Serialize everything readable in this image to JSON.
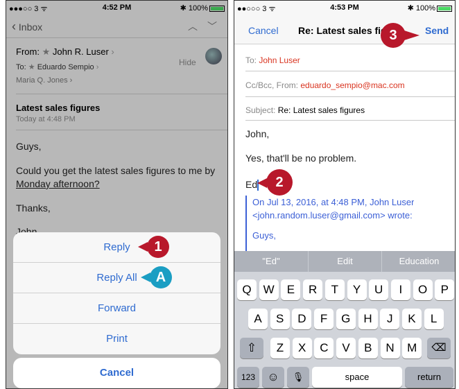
{
  "left": {
    "status": {
      "signal": "●●●○○ 3 ᯤ",
      "time": "4:52 PM",
      "battery": "✱ 100%"
    },
    "nav": {
      "back": "Inbox"
    },
    "from_label": "From:",
    "from_name": "John R. Luser",
    "to_label": "To:",
    "to_name": "Eduardo Sempio",
    "cc_name": "Maria Q. Jones",
    "hide": "Hide",
    "subject": "Latest sales figures",
    "date": "Today at 4:48 PM",
    "body": {
      "greeting": "Guys,",
      "line1": "Could you get the latest sales figures to me by",
      "line2": "Monday afternoon?",
      "thanks": "Thanks,",
      "sig": "John"
    },
    "sheet": {
      "reply": "Reply",
      "reply_all": "Reply All",
      "forward": "Forward",
      "print": "Print",
      "cancel": "Cancel"
    },
    "callouts": {
      "c1": "1",
      "cA": "A"
    }
  },
  "right": {
    "status": {
      "signal": "●●○○○ 3 ᯤ",
      "time": "4:53 PM",
      "battery": "✱ 100%"
    },
    "nav": {
      "cancel": "Cancel",
      "title": "Re: Latest sales figu",
      "send": "Send"
    },
    "to_label": "To:",
    "to_value": "John Luser",
    "cc_label": "Cc/Bcc, From:",
    "cc_value": "eduardo_sempio@mac.com",
    "subject_label": "Subject:",
    "subject_value": "Re: Latest sales figures",
    "body": {
      "greeting": "John,",
      "line": "Yes, that'll be no problem.",
      "sig": "Ed"
    },
    "quoted": {
      "line1": "On Jul 13, 2016, at 4:48 PM, John Luser",
      "line2": "<john.random.luser@gmail.com> wrote:",
      "line3": "Guys,"
    },
    "keyboard": {
      "suggestions": [
        "\"Ed\"",
        "Edit",
        "Education"
      ],
      "row1": [
        "Q",
        "W",
        "E",
        "R",
        "T",
        "Y",
        "U",
        "I",
        "O",
        "P"
      ],
      "row2": [
        "A",
        "S",
        "D",
        "F",
        "G",
        "H",
        "J",
        "K",
        "L"
      ],
      "row3": [
        "Z",
        "X",
        "C",
        "V",
        "B",
        "N",
        "M"
      ],
      "num": "123",
      "emoji": "☺",
      "mic": "🎙",
      "space": "space",
      "ret": "return",
      "shift": "⇧",
      "del": "⌫"
    },
    "callouts": {
      "c2": "2",
      "c3": "3"
    }
  },
  "colors": {
    "accent": "#2f6bd0",
    "callout_red": "#b8182b",
    "callout_teal": "#1b9ec3",
    "recipient": "#d9331f"
  }
}
